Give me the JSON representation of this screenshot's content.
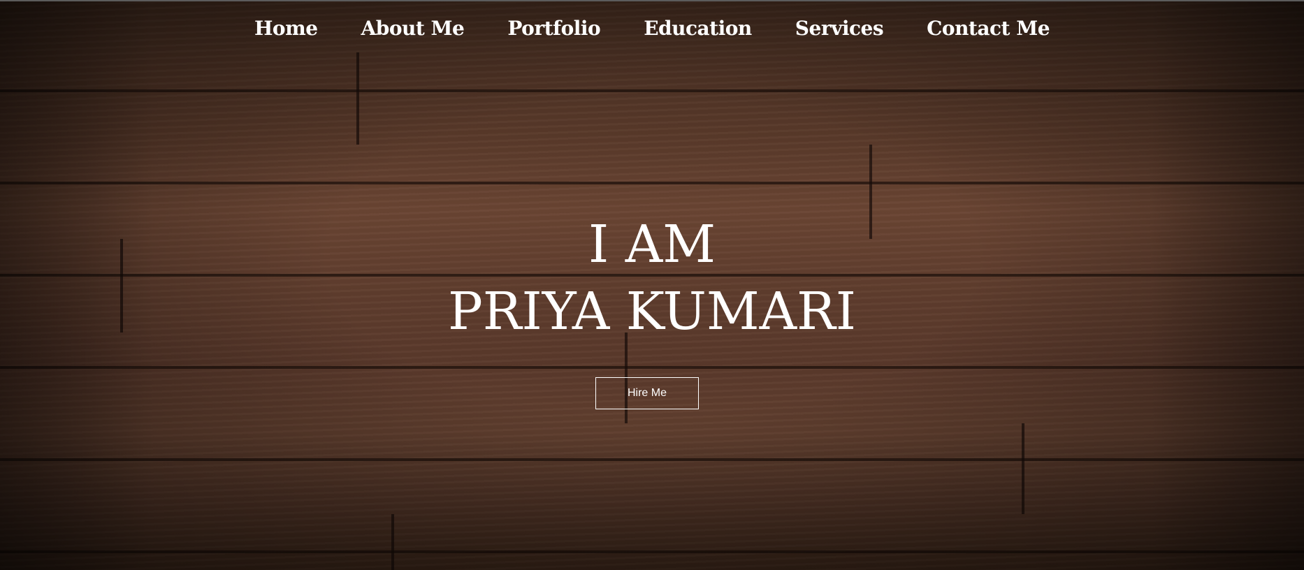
{
  "nav": {
    "items": [
      {
        "label": "Home"
      },
      {
        "label": "About Me"
      },
      {
        "label": "Portfolio"
      },
      {
        "label": "Education"
      },
      {
        "label": "Services"
      },
      {
        "label": "Contact Me"
      }
    ]
  },
  "hero": {
    "line1": "I AM",
    "line2": "PRIYA KUMARI",
    "cta_label": "Hire Me"
  }
}
